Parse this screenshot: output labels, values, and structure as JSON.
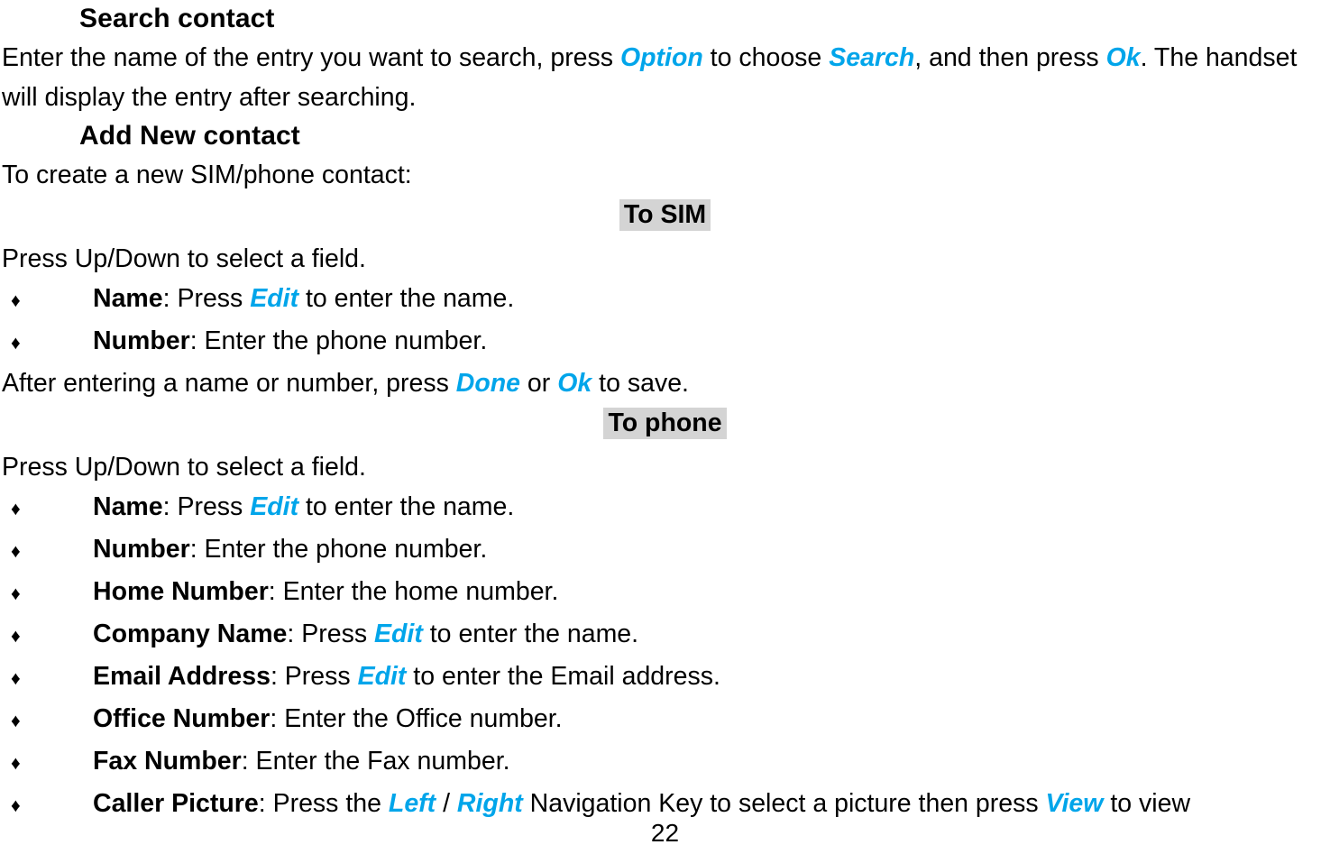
{
  "document": {
    "page_number": "22",
    "accent_color": "#00a5ea",
    "highlight_color": "#d4d4d4",
    "sections": [
      {
        "heading": "Search contact",
        "intro_parts": [
          {
            "text": "Enter the name of the entry you want to search, press ",
            "style": "normal"
          },
          {
            "text": "Option",
            "style": "accent"
          },
          {
            "text": " to choose ",
            "style": "normal"
          },
          {
            "text": "Search",
            "style": "accent"
          },
          {
            "text": ", and then press ",
            "style": "normal"
          },
          {
            "text": "Ok",
            "style": "accent"
          },
          {
            "text": ". The handset will display the entry after searching.",
            "style": "normal"
          }
        ]
      },
      {
        "heading": "Add New contact",
        "intro": "To create a new SIM/phone contact:"
      }
    ],
    "sim_section": {
      "label": "To SIM",
      "instruction": "Press Up/Down to select a field.",
      "bullets": [
        {
          "mark": "♦",
          "term": "Name",
          "after_term": ": Press ",
          "accent": "Edit",
          "tail": " to enter the name."
        },
        {
          "mark": "♦",
          "term": "Number",
          "after_term": ": Enter the phone number.",
          "accent": "",
          "tail": ""
        }
      ],
      "note_parts": [
        {
          "text": "After entering a name or number, press ",
          "style": "normal"
        },
        {
          "text": "Done",
          "style": "accent"
        },
        {
          "text": " or ",
          "style": "normal"
        },
        {
          "text": "Ok",
          "style": "accent"
        },
        {
          "text": " to save.",
          "style": "normal"
        }
      ]
    },
    "phone_section": {
      "label": "To phone",
      "instruction": "Press Up/Down to select a field.",
      "bullets": [
        {
          "mark": "♦",
          "term": "Name",
          "after_term": ": Press ",
          "accent": "Edit",
          "tail": " to enter the name."
        },
        {
          "mark": "♦",
          "term": "Number",
          "after_term": ": Enter the phone number.",
          "accent": "",
          "tail": ""
        },
        {
          "mark": "♦",
          "term": "Home Number",
          "after_term": ": Enter the home number.",
          "accent": "",
          "tail": ""
        },
        {
          "mark": "♦",
          "term": "Company Name",
          "after_term": ": Press ",
          "accent": "Edit",
          "tail": " to enter the name."
        },
        {
          "mark": "♦",
          "term": "Email Address",
          "after_term": ": Press ",
          "accent": "Edit",
          "tail": " to enter the Email address."
        },
        {
          "mark": "♦",
          "term": "Office Number",
          "after_term": ": Enter the Office number.",
          "accent": "",
          "tail": ""
        },
        {
          "mark": "♦",
          "term": "Fax Number",
          "after_term": ": Enter the Fax number.",
          "accent": "",
          "tail": ""
        }
      ],
      "caller_picture": {
        "mark": "♦",
        "term": "Caller Picture",
        "p1": ": Press the ",
        "a1": "Left",
        "sep": " / ",
        "a2": "Right",
        "p2": " Navigation Key to select a picture then press ",
        "a3": "View",
        "p3": " to view"
      }
    }
  }
}
